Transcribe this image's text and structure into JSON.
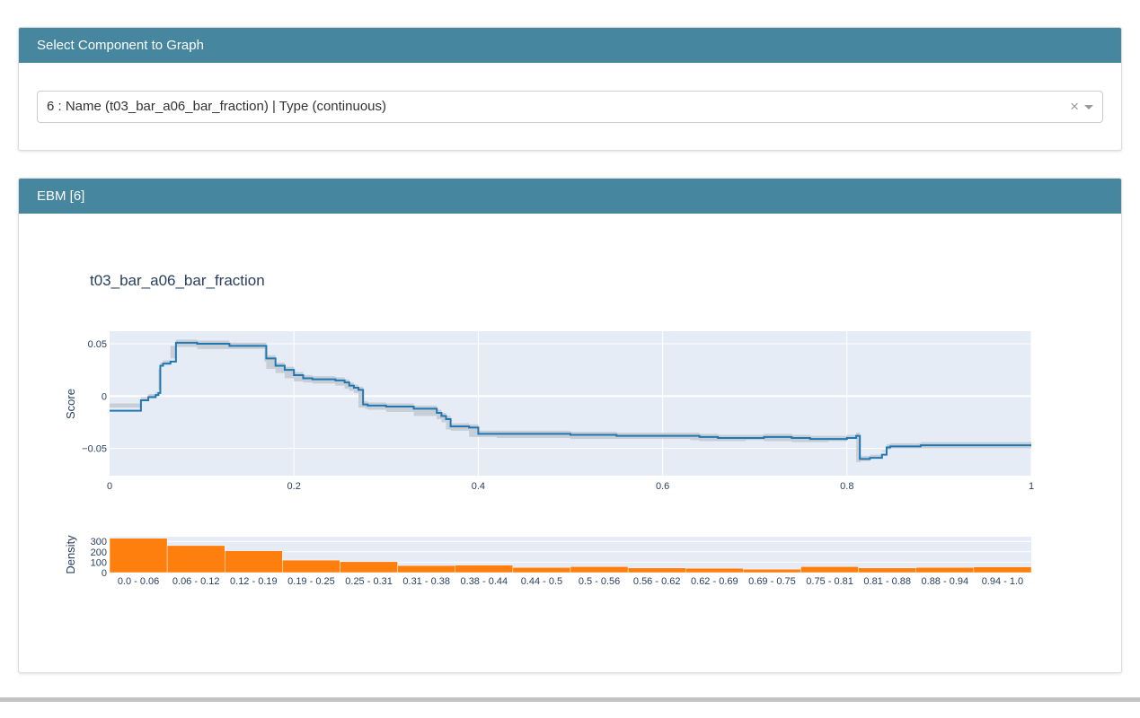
{
  "select_card": {
    "header": "Select Component to Graph",
    "selected_value": "6 : Name (t03_bar_a06_bar_fraction) | Type (continuous)",
    "clear_glyph": "×"
  },
  "ebm_card": {
    "header": "EBM [6]"
  },
  "colors": {
    "header_bg": "#46869f",
    "plot_bg": "#e5ecf6",
    "line": "#1f77b4",
    "band": "#c8ced6",
    "bar": "#ff7f0e"
  },
  "chart_data": [
    {
      "type": "line",
      "title": "t03_bar_a06_bar_fraction",
      "ylabel": "Score",
      "xlabel": "",
      "xlim": [
        0,
        1
      ],
      "ylim": [
        -0.076,
        0.062
      ],
      "x_ticks": [
        0,
        0.2,
        0.4,
        0.6,
        0.8,
        1
      ],
      "x_tick_labels": [
        "0",
        "0.2",
        "0.4",
        "0.6",
        "0.8",
        "1"
      ],
      "y_ticks": [
        0.05,
        0,
        -0.05
      ],
      "y_tick_labels": [
        "0.05",
        "0",
        "−0.05"
      ],
      "grid": true,
      "series": [
        {
          "step_x": [
            0,
            0.034,
            0.042,
            0.05,
            0.053,
            0.055,
            0.058,
            0.066,
            0.072,
            0.095,
            0.13,
            0.168,
            0.17,
            0.18,
            0.19,
            0.2,
            0.21,
            0.22,
            0.245,
            0.255,
            0.26,
            0.265,
            0.27,
            0.275,
            0.277,
            0.28,
            0.3,
            0.33,
            0.355,
            0.36,
            0.365,
            0.37,
            0.39,
            0.4,
            0.42,
            0.5,
            0.55,
            0.63,
            0.64,
            0.66,
            0.69,
            0.71,
            0.74,
            0.76,
            0.78,
            0.8,
            0.81,
            0.814,
            0.815,
            0.825,
            0.838,
            0.843,
            0.847,
            0.88,
            1
          ],
          "step_y": [
            -0.014,
            -0.004,
            -0.001,
            0.001,
            0.003,
            0.029,
            0.031,
            0.033,
            0.051,
            0.05,
            0.048,
            0.048,
            0.036,
            0.029,
            0.025,
            0.02,
            0.017,
            0.016,
            0.015,
            0.013,
            0.01,
            0.008,
            0.006,
            -0.008,
            -0.008,
            -0.009,
            -0.01,
            -0.012,
            -0.016,
            -0.019,
            -0.022,
            -0.029,
            -0.03,
            -0.036,
            -0.036,
            -0.037,
            -0.038,
            -0.038,
            -0.039,
            -0.04,
            -0.04,
            -0.039,
            -0.04,
            -0.041,
            -0.041,
            -0.04,
            -0.038,
            -0.06,
            -0.06,
            -0.059,
            -0.056,
            -0.049,
            -0.048,
            -0.047,
            -0.047
          ],
          "band_halfwidth": 0.003
        }
      ]
    },
    {
      "type": "bar",
      "ylabel": "Density",
      "categories": [
        "0.0 - 0.06",
        "0.06 - 0.12",
        "0.12 - 0.19",
        "0.19 - 0.25",
        "0.25 - 0.31",
        "0.31 - 0.38",
        "0.38 - 0.44",
        "0.44 - 0.5",
        "0.5 - 0.56",
        "0.56 - 0.62",
        "0.62 - 0.69",
        "0.69 - 0.75",
        "0.75 - 0.81",
        "0.81 - 0.88",
        "0.88 - 0.94",
        "0.94 - 1.0"
      ],
      "values": [
        330,
        260,
        210,
        120,
        105,
        68,
        72,
        50,
        58,
        45,
        42,
        33,
        58,
        45,
        50,
        55
      ],
      "ylim": [
        0,
        345
      ],
      "y_ticks": [
        0,
        100,
        200,
        300
      ],
      "y_tick_labels": [
        "0",
        "100",
        "200",
        "300"
      ],
      "grid": true
    }
  ]
}
